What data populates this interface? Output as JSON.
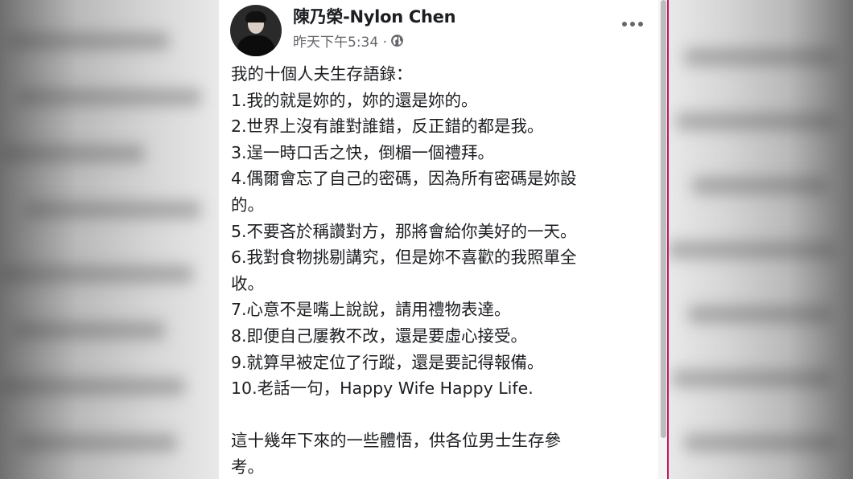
{
  "post": {
    "author": "陳乃榮-Nylon Chen",
    "timestamp": "昨天下午5:34 ·",
    "privacy_icon": "globe-icon",
    "more_icon": "more-options-icon",
    "body_lines": [
      "我的十個人夫生存語錄：",
      "1.我的就是妳的，妳的還是妳的。",
      "2.世界上沒有誰對誰錯，反正錯的都是我。",
      "3.逞一時口舌之快，倒楣一個禮拜。",
      "4.偶爾會忘了自己的密碼，因為所有密碼是妳設",
      "的。",
      "5.不要吝於稱讚對方，那將會給你美好的一天。",
      "6.我對食物挑剔講究，但是妳不喜歡的我照單全",
      "收。",
      "7.心意不是嘴上說說，請用禮物表達。",
      "8.即便自己屢教不改，還是要虛心接受。",
      "9.就算早被定位了行蹤，還是要記得報備。",
      "10.老話一句，Happy Wife Happy Life.",
      "",
      "這十幾年下來的一些體悟，供各位男士生存參",
      "考。"
    ]
  },
  "colors": {
    "text": "#1c1e21",
    "secondary": "#65676b",
    "card_bg": "#ffffff",
    "edge_accent": "#c2185b"
  }
}
